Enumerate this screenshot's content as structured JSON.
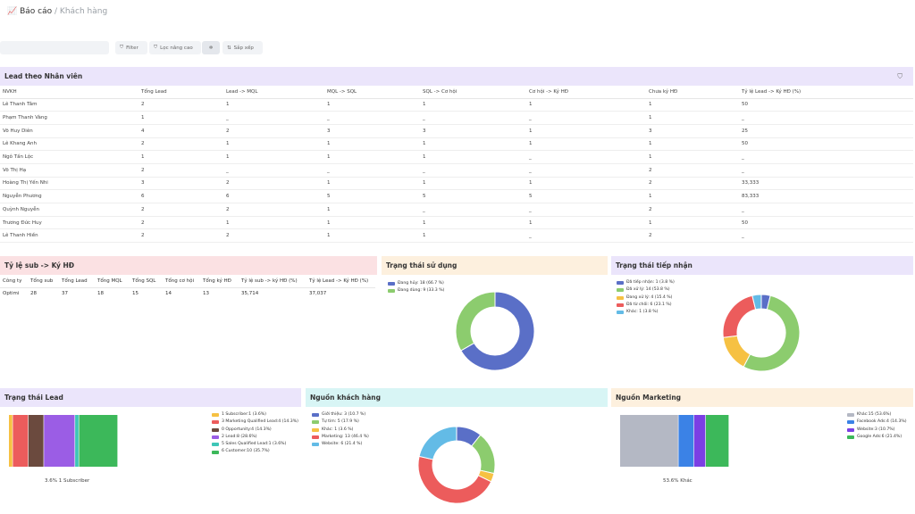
{
  "breadcrumb": {
    "root": "Báo cáo",
    "separator": "/",
    "current": "Khách hàng"
  },
  "toolbar": {
    "filter": "Filter",
    "advanced_filter": "Lọc nâng cao",
    "sort": "Sắp xếp"
  },
  "lead_panel": {
    "title": "Lead theo Nhân viên",
    "columns": [
      "NVKH",
      "Tổng Lead",
      "Lead -> MQL",
      "MQL -> SQL",
      "SQL -> Cơ hội",
      "Cơ hội -> Ký HĐ",
      "Chưa ký HĐ",
      "Tỷ lệ Lead -> Ký HĐ (%)"
    ],
    "rows": [
      [
        "Lê Thanh Tâm",
        "2",
        "1",
        "1",
        "1",
        "1",
        "1",
        "50"
      ],
      [
        "Phạm Thanh Vàng",
        "1",
        "_",
        "_",
        "_",
        "_",
        "1",
        "_"
      ],
      [
        "Võ Huy Diên",
        "4",
        "2",
        "3",
        "3",
        "1",
        "3",
        "25"
      ],
      [
        "Lê Khang Anh",
        "2",
        "1",
        "1",
        "1",
        "1",
        "1",
        "50"
      ],
      [
        "Ngô Tấn Lộc",
        "1",
        "1",
        "1",
        "1",
        "_",
        "1",
        "_"
      ],
      [
        "Võ Thị Hạ",
        "2",
        "_",
        "_",
        "_",
        "_",
        "2",
        "_"
      ],
      [
        "Hoàng Thị Yến Nhi",
        "3",
        "2",
        "1",
        "1",
        "1",
        "2",
        "33,333"
      ],
      [
        "Nguyễn Phương",
        "6",
        "6",
        "5",
        "5",
        "5",
        "1",
        "83,333"
      ],
      [
        "Quỳnh Nguyễn",
        "2",
        "2",
        "1",
        "_",
        "_",
        "2",
        "_"
      ],
      [
        "Trương Đức Huy",
        "2",
        "1",
        "1",
        "1",
        "1",
        "1",
        "50"
      ],
      [
        "Lê Thanh Hiền",
        "2",
        "2",
        "1",
        "1",
        "_",
        "2",
        "_"
      ]
    ]
  },
  "sub_panel": {
    "title": "Tỷ lệ sub -> Ký HĐ",
    "columns": [
      "Công ty",
      "Tổng sub",
      "Tổng Lead",
      "Tổng MQL",
      "Tổng SQL",
      "Tổng cơ hội",
      "Tổng ký HĐ",
      "Tỷ lệ sub -> ký HĐ (%)",
      "Tỷ lệ Lead -> Ký HĐ (%)"
    ],
    "rows": [
      [
        "Optimi",
        "28",
        "37",
        "18",
        "15",
        "14",
        "13",
        "35,714",
        "37,037"
      ]
    ]
  },
  "usage_status": {
    "title": "Trạng thái sử dụng",
    "colors": [
      "#5a6fc7",
      "#8ccc6e"
    ],
    "chart_data": {
      "type": "pie",
      "labels": [
        "Đang hủy: 18 (66.7 %)",
        "Đang dùng: 9 (33.3 %)"
      ],
      "values": [
        66.7,
        33.3
      ]
    }
  },
  "reception_status": {
    "title": "Trạng thái tiếp nhận",
    "colors": [
      "#5a6fc7",
      "#8ccc6e",
      "#f6c143",
      "#ec5c5c",
      "#63bbe6"
    ],
    "chart_data": {
      "type": "pie",
      "labels": [
        "Đã tiếp nhận: 1 (3.8 %)",
        "Đã xử lý: 14 (53.8 %)",
        "Đang xử lý: 4 (15.4 %)",
        "Đã từ chối: 6 (23.1 %)",
        "Khác: 1 (3.8 %)"
      ],
      "values": [
        3.8,
        53.8,
        15.4,
        23.1,
        3.8
      ]
    }
  },
  "lead_status": {
    "title": "Trạng thái Lead",
    "caption": "3.6% 1 Subscriber",
    "colors": [
      "#f6c143",
      "#ec5c5c",
      "#6b4a3e",
      "#9b5de5",
      "#3ec6b7",
      "#3cb85a"
    ],
    "chart_data": {
      "type": "bar",
      "labels": [
        "1 Subscriber:1 (3.6%)",
        "3 Marketing Qualified Lead:4 (14.3%)",
        "0 Opportunity:4 (14.3%)",
        "2 Lead:8 (28.6%)",
        "5 Sales Qualified Lead:1 (3.6%)",
        "6 Customer:10 (35.7%)"
      ],
      "values": [
        3.6,
        14.3,
        14.3,
        28.6,
        3.6,
        35.7
      ]
    }
  },
  "customer_source": {
    "title": "Nguồn khách hàng",
    "colors": [
      "#5a6fc7",
      "#8ccc6e",
      "#f6c143",
      "#ec5c5c",
      "#63bbe6"
    ],
    "chart_data": {
      "type": "pie",
      "labels": [
        "Giới thiệu: 3 (10.7 %)",
        "Tự tìm: 5 (17.9 %)",
        "Khác: 1 (3.6 %)",
        "Marketing: 13 (46.4 %)",
        "Website: 6 (21.4 %)"
      ],
      "values": [
        10.7,
        17.9,
        3.6,
        46.4,
        21.4
      ]
    }
  },
  "marketing_source": {
    "title": "Nguồn Marketing",
    "caption": "53.6% Khác",
    "colors": [
      "#b4b8c4",
      "#3b82e6",
      "#7b3fe4",
      "#3cb85a"
    ],
    "chart_data": {
      "type": "bar",
      "labels": [
        "Khác:15 (53.6%)",
        "Facebook Ads:4 (14.3%)",
        "Website:3 (10.7%)",
        "Google Ads:6 (21.4%)"
      ],
      "values": [
        53.6,
        14.3,
        10.7,
        21.4
      ]
    }
  }
}
